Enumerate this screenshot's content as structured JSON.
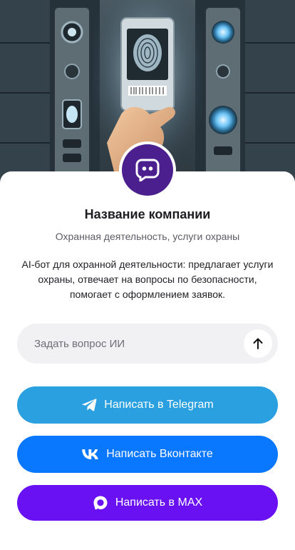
{
  "company": {
    "name": "Название компании",
    "subtitle": "Охранная деятельность, услуги охраны",
    "description": "AI-бот для охранной деятельности: предлагает услуги охраны, отвечает на вопросы по безопасности, помогает с оформлением заявок."
  },
  "ask": {
    "placeholder": "Задать вопрос ИИ",
    "send_icon": "arrow-up-icon"
  },
  "buttons": {
    "telegram": {
      "label": "Написать в Telegram",
      "icon": "telegram-icon"
    },
    "vk": {
      "label": "Написать Вконтакте",
      "icon": "vk-icon"
    },
    "max": {
      "label": "Написать в MAX",
      "icon": "max-icon"
    }
  },
  "hero": {
    "icon": "security-scanner-image"
  },
  "colors": {
    "avatar": "#4b1f8e",
    "telegram": "#2aa0e0",
    "vk": "#0a77ff",
    "max": "#6a11f4",
    "ask_bg": "#f1f1f3"
  }
}
